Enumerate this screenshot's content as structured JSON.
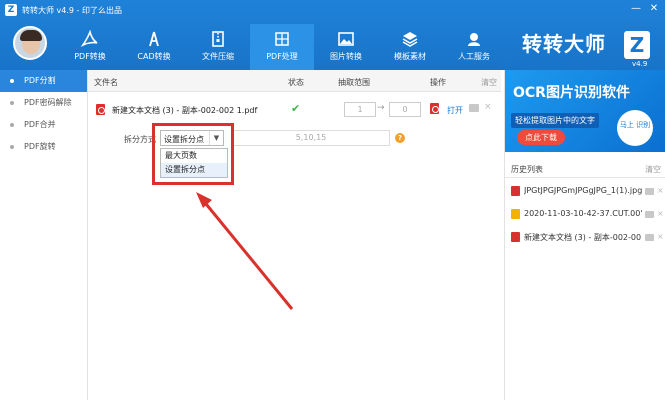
{
  "app": {
    "logo": "Z",
    "title": "转转大师 v4.9 - 印了么出品",
    "brand": "转转大师",
    "brand_logo": "Z",
    "version": "v4.9"
  },
  "window": {
    "min": "—",
    "close": "✕"
  },
  "nav": [
    {
      "label": "PDF转换",
      "icon": "pdf-icon"
    },
    {
      "label": "CAD转换",
      "icon": "cad-icon"
    },
    {
      "label": "文件压缩",
      "icon": "zip-icon"
    },
    {
      "label": "PDF处理",
      "icon": "pdf-process-icon"
    },
    {
      "label": "图片转换",
      "icon": "image-icon"
    },
    {
      "label": "模板素材",
      "icon": "layers-icon"
    },
    {
      "label": "人工服务",
      "icon": "headset-icon"
    }
  ],
  "sidebar": [
    {
      "label": "PDF分割",
      "active": true
    },
    {
      "label": "PDF密码解除",
      "active": false
    },
    {
      "label": "PDF合并",
      "active": false
    },
    {
      "label": "PDF旋转",
      "active": false
    }
  ],
  "table": {
    "headers": {
      "name": "文件名",
      "status": "状态",
      "range": "抽取范围",
      "action": "操作",
      "clear": "清空"
    },
    "file": {
      "name": "新建文本文档 (3) - 副本-002-002 1.pdf",
      "status_icon": "✔",
      "from": "1",
      "to": "0",
      "arrow": "→",
      "open": "打开",
      "close": "×"
    }
  },
  "split": {
    "label": "拆分方式",
    "selected": "设置拆分点",
    "caret": "▼",
    "pages_placeholder": "5,10,15",
    "help": "?",
    "options": [
      "最大页数",
      "设置拆分点"
    ]
  },
  "ad": {
    "title": "OCR图片识别软件",
    "subtitle": "轻松提取图片中的文字",
    "button": "点此下载",
    "qr_text": "马上\n识别"
  },
  "history": {
    "title": "历史列表",
    "clear": "清空",
    "items": [
      {
        "name": "JPGtJPGJPGmJPGgJPG_1(1).jpg",
        "color": "#d8322f"
      },
      {
        "name": "2020-11-03-10-42-37.CUT.00'…",
        "color": "#f0b400"
      },
      {
        "name": "新建文本文档 (3) - 副本-002-00…",
        "color": "#d8322f"
      }
    ],
    "x": "×"
  },
  "colors": {
    "accent": "#1a78d0",
    "highlight": "#d9312b"
  }
}
